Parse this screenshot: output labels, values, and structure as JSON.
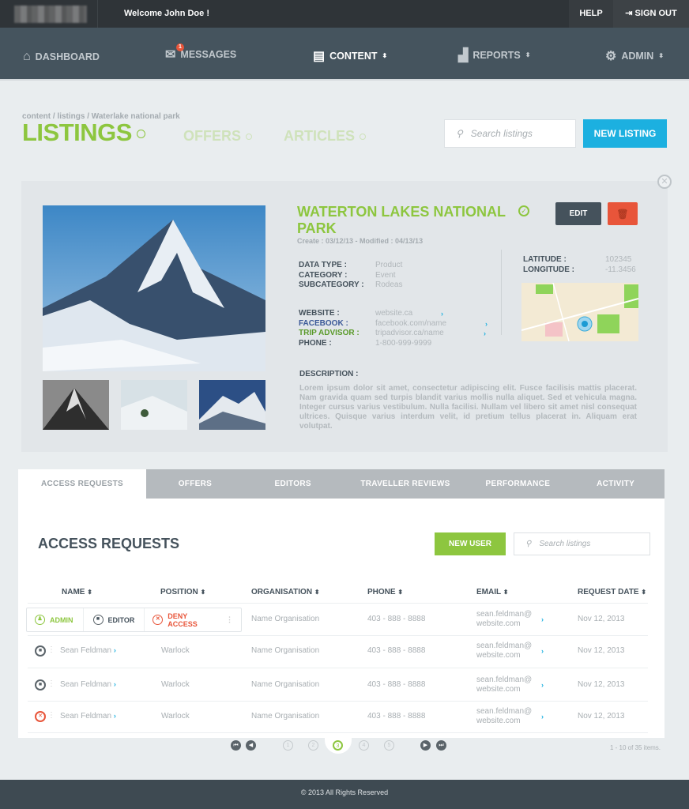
{
  "topbar": {
    "welcome": "Welcome John Doe !",
    "help": "HELP",
    "signout": "SIGN OUT"
  },
  "nav": [
    {
      "label": "DASHBOARD",
      "icon": "home-icon"
    },
    {
      "label": "MESSAGES",
      "icon": "envelope-icon",
      "badge": "1"
    },
    {
      "label": "CONTENT",
      "icon": "document-icon",
      "active": true
    },
    {
      "label": "REPORTS",
      "icon": "bar-chart-icon"
    },
    {
      "label": "ADMIN",
      "icon": "gear-icon"
    }
  ],
  "breadcrumb": "content / listings / Waterlake national park",
  "sections": {
    "listings": "LISTINGS",
    "offers": "OFFERS",
    "articles": "ARTICLES"
  },
  "search": {
    "placeholder": "Search listings"
  },
  "new_listing": "NEW LISTING",
  "listing": {
    "title": "WATERTON LAKES NATIONAL PARK",
    "dates": "Create : 03/12/13  -  Modified : 04/13/13",
    "edit": "EDIT",
    "fields": [
      {
        "k": "DATA TYPE :",
        "v": "Product"
      },
      {
        "k": "CATEGORY :",
        "v": "Event"
      },
      {
        "k": "SUBCATEGORY :",
        "v": "Rodeas"
      }
    ],
    "links": [
      {
        "k": "WEBSITE :",
        "v": "website.ca",
        "color": "#45525c"
      },
      {
        "k": "FACEBOOK :",
        "v": "facebook.com/name",
        "color": "#3b5998"
      },
      {
        "k": "TRIP ADVISOR :",
        "v": "tripadvisor.ca/name",
        "color": "#5a9a2a"
      },
      {
        "k": "PHONE :",
        "v": "1-800-999-9999",
        "color": "#45525c"
      }
    ],
    "latitude_label": "LATITUDE :",
    "latitude": "102345",
    "longitude_label": "LONGITUDE :",
    "longitude": "-11.3456",
    "description_label": "DESCRIPTION :",
    "description": "Lorem ipsum dolor sit amet, consectetur adipiscing elit. Fusce facilisis mattis placerat. Nam gravida quam sed turpis blandit varius mollis nulla aliquet. Sed et vehicula magna. Integer cursus varius vestibulum. Nulla facilisi. Nullam vel libero sit amet nisl consequat ultrices. Quisque varius interdum velit, id pretium tellus placerat in. Aliquam erat volutpat."
  },
  "tabs": [
    "ACCESS REQUESTS",
    "OFFERS",
    "EDITORS",
    "TRAVELLER REVIEWS",
    "PERFORMANCE",
    "ACTIVITY"
  ],
  "access": {
    "title": "ACCESS REQUESTS",
    "new_user": "NEW USER",
    "search_placeholder": "Search listings",
    "columns": [
      "NAME",
      "POSITION",
      "ORGANISATION",
      "PHONE",
      "EMAIL",
      "REQUEST DATE"
    ],
    "actions": {
      "admin": "ADMIN",
      "editor": "EDITOR",
      "deny": "DENY ACCESS"
    },
    "rows": [
      {
        "name": "",
        "position": "",
        "org": "Name Organisation",
        "phone": "403 - 888 - 8888",
        "email1": "sean.feldman@",
        "email2": "website.com",
        "date": "Nov 12, 2013",
        "status": "menu-open"
      },
      {
        "name": "Sean Feldman",
        "position": "Warlock",
        "org": "Name Organisation",
        "phone": "403 - 888 - 8888",
        "email1": "sean.feldman@",
        "email2": "website.com",
        "date": "Nov 12, 2013",
        "status": "editor"
      },
      {
        "name": "Sean Feldman",
        "position": "Warlock",
        "org": "Name Organisation",
        "phone": "403 - 888 - 8888",
        "email1": "sean.feldman@",
        "email2": "website.com",
        "date": "Nov 12, 2013",
        "status": "editor"
      },
      {
        "name": "Sean Feldman",
        "position": "Warlock",
        "org": "Name Organisation",
        "phone": "403 - 888 - 8888",
        "email1": "sean.feldman@",
        "email2": "website.com",
        "date": "Nov 12, 2013",
        "status": "denied"
      }
    ]
  },
  "pagination": {
    "pages": [
      "1",
      "2",
      "3",
      "4",
      "5"
    ],
    "current": "3",
    "summary": "1 - 10 of 35 items."
  },
  "footer": "©  2013 All Rights Reserved",
  "colors": {
    "green": "#8dc63f",
    "blue": "#1cb0e0",
    "red": "#e8553a",
    "dark": "#45525c"
  }
}
